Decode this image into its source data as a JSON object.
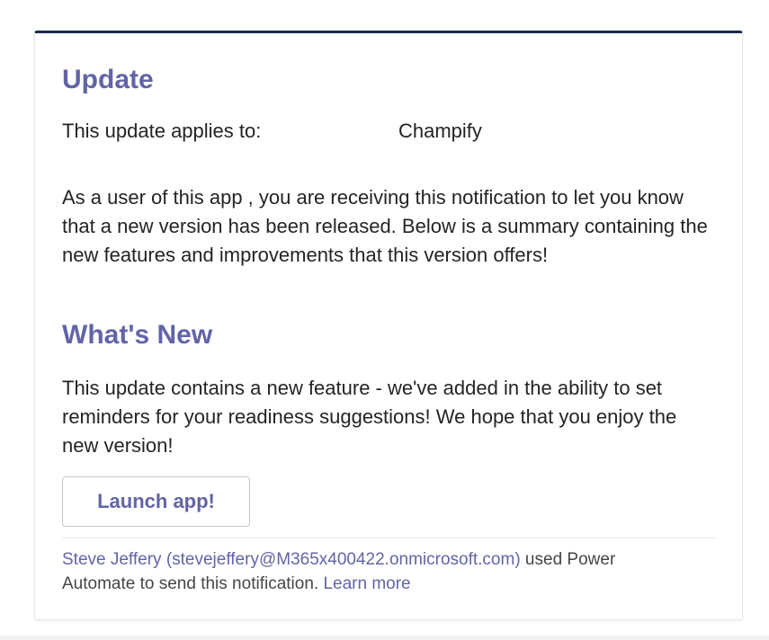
{
  "card": {
    "update_heading": "Update",
    "applies_label": "This update applies to:",
    "app_name": "Champify",
    "intro_text": "As a user of this app , you are receiving this notification to let you know that a new version has been released. Below is a summary containing the new features and improvements that this version offers!",
    "whats_new_heading": "What's New",
    "feature_text": "This update contains a new feature - we've added in the ability to set reminders for your readiness suggestions! We hope that you enjoy the new version!",
    "launch_button": "Launch app!"
  },
  "footer": {
    "sender_link": "Steve Jeffery (stevejeffery@M365x400422.onmicrosoft.com)",
    "used_text": " used Power Automate to send this notification. ",
    "learn_more": "Learn more"
  },
  "colors": {
    "accent": "#6264a7",
    "top_border": "#1a2b4c",
    "text": "#252423"
  }
}
